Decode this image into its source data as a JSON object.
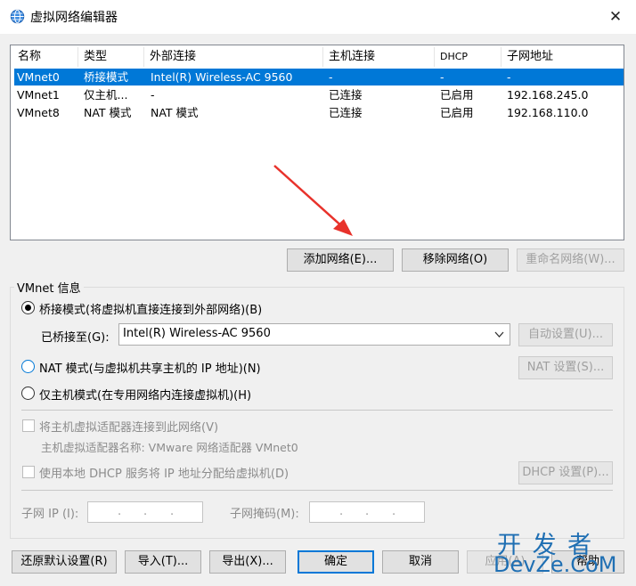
{
  "window": {
    "title": "虚拟网络编辑器",
    "close_glyph": "✕"
  },
  "network_list": {
    "columns": [
      "名称",
      "类型",
      "外部连接",
      "主机连接",
      "DHCP",
      "子网地址"
    ],
    "rows": [
      [
        "VMnet0",
        "桥接模式",
        "Intel(R) Wireless-AC 9560",
        "-",
        "-",
        "-"
      ],
      [
        "VMnet1",
        "仅主机...",
        "-",
        "已连接",
        "已启用",
        "192.168.245.0"
      ],
      [
        "VMnet8",
        "NAT 模式",
        "NAT 模式",
        "已连接",
        "已启用",
        "192.168.110.0"
      ]
    ],
    "selected_row": 0
  },
  "list_buttons": {
    "add": "添加网络(E)...",
    "remove": "移除网络(O)",
    "rename": "重命名网络(W)..."
  },
  "vmnet_info": {
    "group_label": "VMnet 信息",
    "bridged_label": "桥接模式(将虚拟机直接连接到外部网络)(B)",
    "bridged_to_label": "已桥接至(G):",
    "bridged_to_value": "Intel(R) Wireless-AC 9560",
    "auto_settings": "自动设置(U)...",
    "nat_label": "NAT 模式(与虚拟机共享主机的 IP 地址)(N)",
    "nat_settings": "NAT 设置(S)...",
    "host_only_label": "仅主机模式(在专用网络内连接虚拟机)(H)",
    "connect_adapter_label": "将主机虚拟适配器连接到此网络(V)",
    "adapter_name_label": "主机虚拟适配器名称: VMware 网络适配器 VMnet0",
    "dhcp_label": "使用本地 DHCP 服务将 IP 地址分配给虚拟机(D)",
    "dhcp_settings": "DHCP 设置(P)...",
    "subnet_ip_label": "子网 IP (I):",
    "subnet_mask_label": "子网掩码(M):",
    "ip_dot": "."
  },
  "footer_buttons": {
    "restore": "还原默认设置(R)",
    "import": "导入(T)...",
    "export": "导出(X)...",
    "ok": "确定",
    "cancel": "取消",
    "apply": "应用(A)",
    "help": "帮助"
  },
  "watermark": {
    "line1": "开 发 者",
    "line2": "DevZe.CoM"
  },
  "colors": {
    "selection": "#0078d7",
    "arrow": "#e8322b"
  }
}
